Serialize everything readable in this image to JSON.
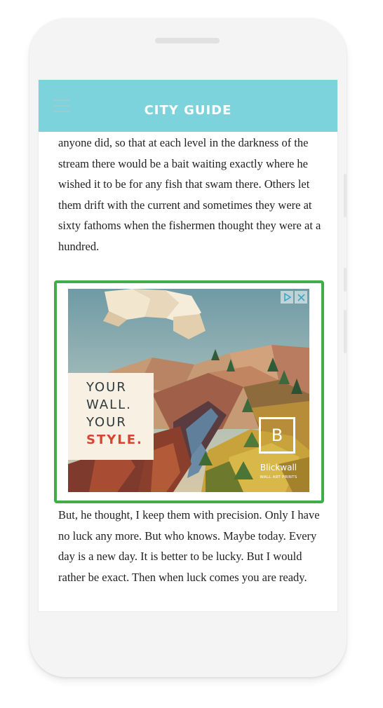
{
  "app": {
    "title": "CITY GUIDE",
    "header_color": "#7dd3dc"
  },
  "article": {
    "paragraph_1": "anyone did, so that at each level in the darkness of the stream there would be a bait waiting exactly where he wished it to be for any fish that swam there. Others let them drift with the current and sometimes they were at sixty fathoms when the fishermen thought they were at a hundred.",
    "paragraph_2": "But, he thought, I keep them with precision. Only I have no luck any more. But who knows. Maybe today. Every day is a new day. It is better to be lucky. But I would rather be exact. Then when luck comes you are ready."
  },
  "ad": {
    "highlight_color": "#3fae49",
    "headline_lines": [
      "YOUR",
      "WALL.",
      "YOUR",
      "STYLE."
    ],
    "headline_accent_color": "#d9432f",
    "logo_letter": "B",
    "brand": "Blickwall",
    "tagline": "WALL ART PRINTS",
    "badge_icons": [
      "adchoices-icon",
      "close-icon"
    ]
  },
  "icons": {
    "menu": "hamburger-menu-icon"
  }
}
